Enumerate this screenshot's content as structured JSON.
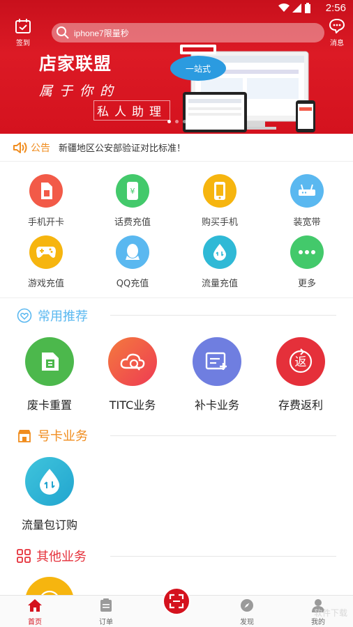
{
  "status_bar": {
    "time": "2:56"
  },
  "header": {
    "signin_label": "签到",
    "message_label": "消息",
    "search_placeholder": "iphone7限量秒"
  },
  "banner": {
    "brand_title": "店家联盟",
    "slogan_line1": "属于你的",
    "slogan_line2": "私人助理",
    "slide_count": 3,
    "active_slide": 1
  },
  "notice": {
    "label": "公告",
    "text": "新疆地区公安部验证对比标准！"
  },
  "quick_services": [
    {
      "label": "手机开卡",
      "icon": "sim-card-icon",
      "color": "#f25a48"
    },
    {
      "label": "话费充值",
      "icon": "phone-recharge-icon",
      "color": "#43c96b"
    },
    {
      "label": "购买手机",
      "icon": "mobile-phone-icon",
      "color": "#f6b50f"
    },
    {
      "label": "装宽带",
      "icon": "router-icon",
      "color": "#5ab8f0"
    },
    {
      "label": "游戏充值",
      "icon": "gamepad-icon",
      "color": "#f6b50f"
    },
    {
      "label": "QQ充值",
      "icon": "qq-icon",
      "color": "#5ab8f0"
    },
    {
      "label": "流量充值",
      "icon": "data-drop-icon",
      "color": "#2fb9d6"
    },
    {
      "label": "更多",
      "icon": "more-icon",
      "color": "#43c96b"
    }
  ],
  "sections": {
    "recommended": {
      "title": "常用推荐",
      "color": "#5ab8f0",
      "items": [
        {
          "label": "废卡重置",
          "icon": "sim-reset-icon",
          "color": "#4cb84c"
        },
        {
          "label": "TITC业务",
          "icon": "cloud-search-icon",
          "color": "#f2534a"
        },
        {
          "label": "补卡业务",
          "icon": "card-add-icon",
          "color": "#6f7ee0"
        },
        {
          "label": "存费返利",
          "icon": "rebate-icon",
          "color": "#e5303a"
        }
      ]
    },
    "number_card": {
      "title": "号卡业务",
      "color": "#f08c1e",
      "items": [
        {
          "label": "流量包订购",
          "icon": "data-package-icon",
          "color": "#2fb9d6"
        }
      ]
    },
    "other": {
      "title": "其他业务",
      "color": "#e5303a"
    }
  },
  "bottom_nav": [
    {
      "label": "首页",
      "icon": "home-icon",
      "active": true
    },
    {
      "label": "订单",
      "icon": "order-icon",
      "active": false
    },
    {
      "label": "",
      "icon": "scan-icon",
      "active": false
    },
    {
      "label": "发现",
      "icon": "compass-icon",
      "active": false
    },
    {
      "label": "我的",
      "icon": "profile-icon",
      "active": false
    }
  ],
  "watermark": "软件下载"
}
